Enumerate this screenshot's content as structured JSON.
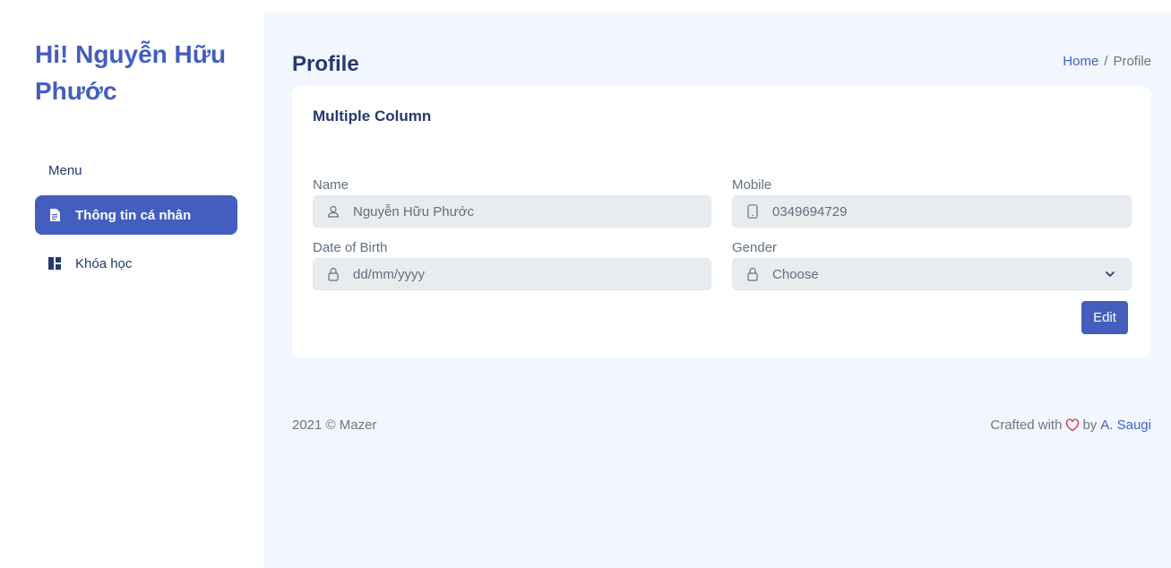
{
  "sidebar": {
    "greeting": "Hi! Nguyễn Hữu Phước",
    "menu_title": "Menu",
    "items": [
      {
        "label": "Thông tin cá nhân",
        "icon": "file-icon",
        "active": true
      },
      {
        "label": "Khóa học",
        "icon": "grid-icon",
        "active": false
      }
    ]
  },
  "header": {
    "title": "Profile",
    "breadcrumb": [
      "Home",
      "Profile"
    ],
    "breadcrumb_separator": "/"
  },
  "form": {
    "card_title": "Multiple Column",
    "fields": {
      "name": {
        "label": "Name",
        "value": "Nguyễn Hữu Phước",
        "icon": "person-icon"
      },
      "mobile": {
        "label": "Mobile",
        "value": "0349694729",
        "icon": "phone-icon"
      },
      "dob": {
        "label": "Date of Birth",
        "value": "dd/mm/yyyy",
        "icon": "lock-icon"
      },
      "gender": {
        "label": "Gender",
        "value": "Choose",
        "icon": "lock-icon"
      }
    },
    "edit_label": "Edit"
  },
  "footer": {
    "copyright": "2021 © Mazer",
    "crafted_prefix": "Crafted with",
    "crafted_by": "by",
    "author": "A. Saugi"
  },
  "colors": {
    "primary": "#435ebe",
    "heading": "#25396f",
    "main_bg": "#f2f7ff",
    "input_bg": "#e9ecef",
    "heart": "#dc3545"
  }
}
